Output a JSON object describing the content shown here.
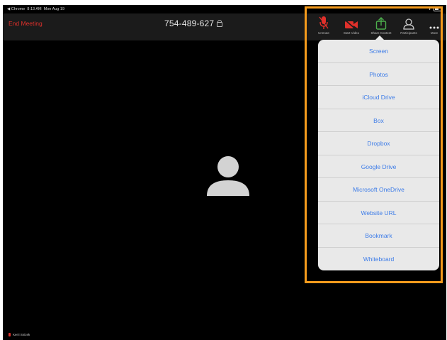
{
  "status_bar": {
    "back_app": "◀ Chrome",
    "time": "8:13 AM",
    "date": "Mon Aug 19",
    "battery": "62%"
  },
  "header": {
    "end_meeting_label": "End Meeting",
    "meeting_id": "754-489-627"
  },
  "toolbar": {
    "items": [
      {
        "label": "Unmute",
        "icon": "microphone-muted-icon"
      },
      {
        "label": "Start Video",
        "icon": "video-off-icon"
      },
      {
        "label": "Share Content",
        "icon": "share-content-icon"
      },
      {
        "label": "Participants",
        "icon": "participants-icon"
      },
      {
        "label": "More",
        "icon": "more-icon"
      }
    ]
  },
  "share_menu": {
    "items": [
      "Screen",
      "Photos",
      "iCloud Drive",
      "Box",
      "Dropbox",
      "Google Drive",
      "Microsoft OneDrive",
      "Website URL",
      "Bookmark",
      "Whiteboard"
    ]
  },
  "self_view": {
    "name": "Kerri Snizek"
  },
  "colors": {
    "highlight_frame": "#f59b1c",
    "end_meeting": "#e0302b",
    "menu_text": "#3d7ce8",
    "share_icon": "#4cae4c"
  }
}
